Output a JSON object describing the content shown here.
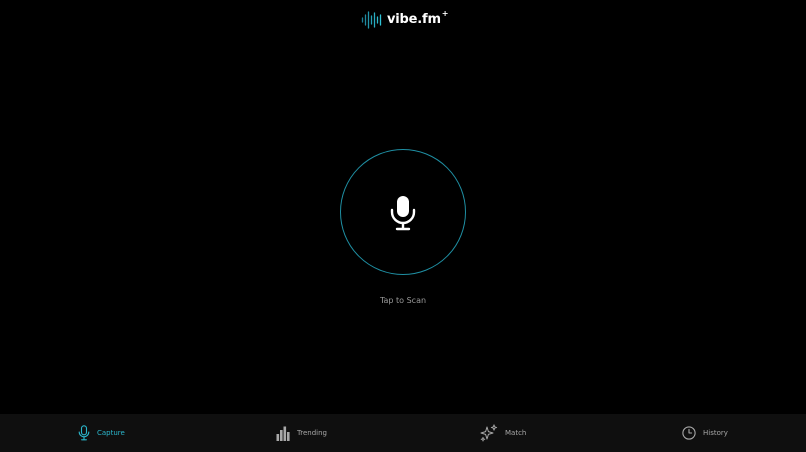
{
  "app": {
    "logo_text": "vibe.fm",
    "logo_sup": "+"
  },
  "scan": {
    "label": "Tap to Scan",
    "icon": "microphone-icon"
  },
  "nav": {
    "items": [
      {
        "label": "Capture",
        "icon": "microphone-icon",
        "active": true
      },
      {
        "label": "Trending",
        "icon": "bar-chart-icon",
        "active": false
      },
      {
        "label": "Match",
        "icon": "sparkles-icon",
        "active": false
      },
      {
        "label": "History",
        "icon": "clock-icon",
        "active": false
      }
    ]
  },
  "colors": {
    "background": "#000000",
    "nav_background": "#0f0f0f",
    "accent": "#2bb7cc",
    "ring": "#1f8fa3",
    "inactive": "#a8a8a8",
    "text_muted": "#9a9a9a"
  }
}
